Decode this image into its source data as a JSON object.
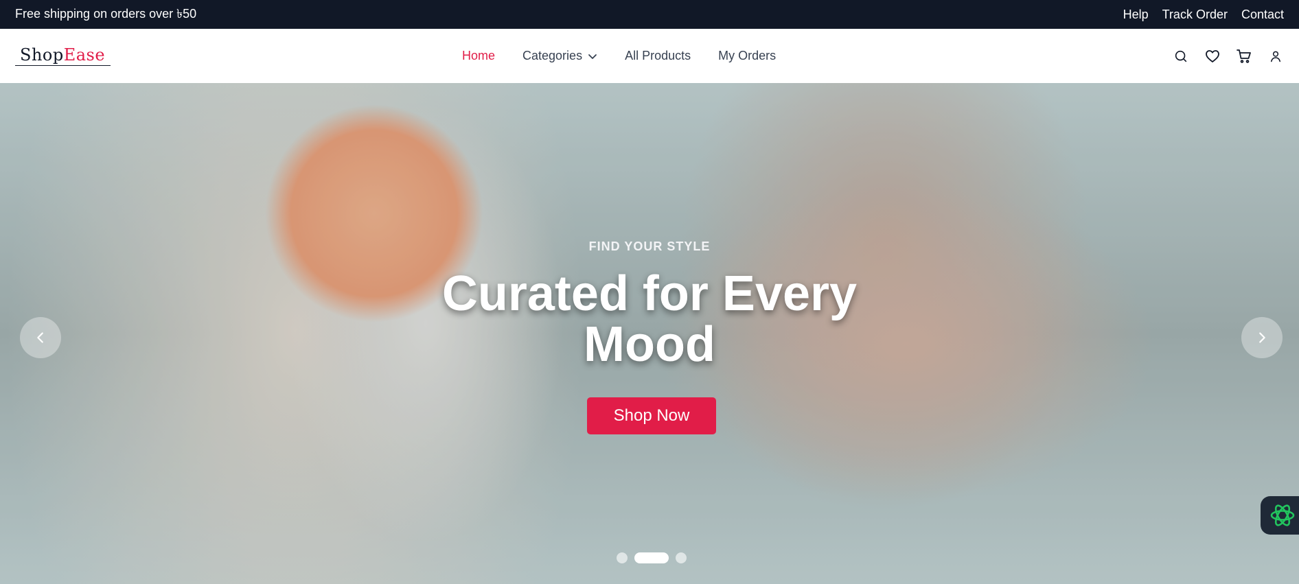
{
  "topbar": {
    "promo": "Free shipping on orders over ৳50",
    "links": [
      "Help",
      "Track Order",
      "Contact"
    ]
  },
  "header": {
    "logo": {
      "part1": "Shop",
      "part2": "Ease"
    },
    "nav": [
      "Home",
      "Categories",
      "All Products",
      "My Orders"
    ],
    "active_nav": "Home",
    "icons": [
      "search-icon",
      "heart-icon",
      "cart-icon",
      "user-icon"
    ]
  },
  "hero": {
    "eyebrow": "FIND YOUR STYLE",
    "headline": "Curated for Every Mood",
    "cta": "Shop Now",
    "slides": {
      "count": 3,
      "active_index": 1
    }
  },
  "colors": {
    "accent": "#e11d48",
    "topbar_bg": "#111827",
    "assistant_icon": "#22c55e"
  }
}
